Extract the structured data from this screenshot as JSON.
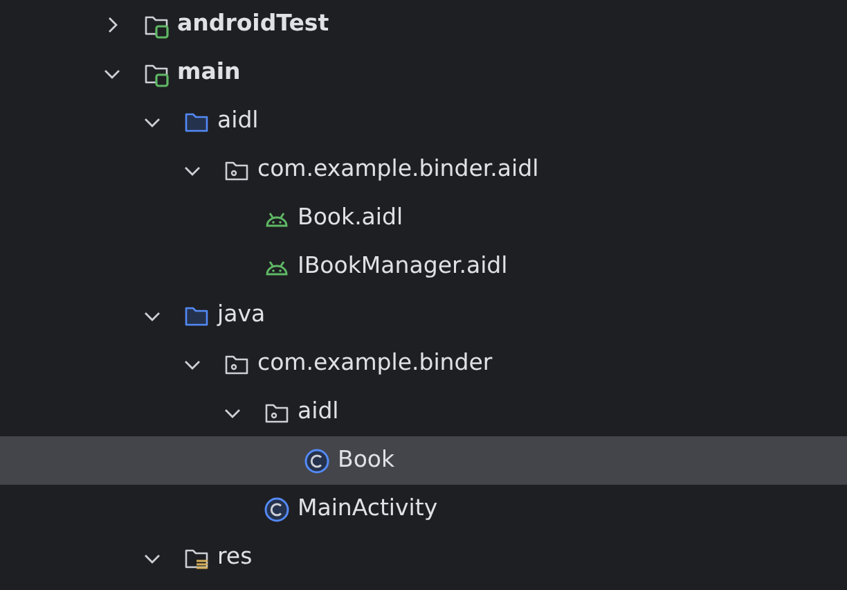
{
  "tree": [
    {
      "label": "androidTest",
      "kind": "module-folder",
      "expanded": false,
      "selected": false
    },
    {
      "label": "main",
      "kind": "module-folder",
      "expanded": true,
      "selected": false,
      "children": [
        {
          "label": "aidl",
          "kind": "source-folder",
          "expanded": true,
          "selected": false,
          "children": [
            {
              "label": "com.example.binder.aidl",
              "kind": "package",
              "expanded": true,
              "selected": false,
              "children": [
                {
                  "label": "Book.aidl",
                  "kind": "aidl-file",
                  "selected": false
                },
                {
                  "label": "IBookManager.aidl",
                  "kind": "aidl-file",
                  "selected": false
                }
              ]
            }
          ]
        },
        {
          "label": "java",
          "kind": "source-folder",
          "expanded": true,
          "selected": false,
          "children": [
            {
              "label": "com.example.binder",
              "kind": "package",
              "expanded": true,
              "selected": false,
              "children": [
                {
                  "label": "aidl",
                  "kind": "package",
                  "expanded": true,
                  "selected": false,
                  "children": [
                    {
                      "label": "Book",
                      "kind": "class",
                      "selected": true
                    }
                  ]
                },
                {
                  "label": "MainActivity",
                  "kind": "class",
                  "selected": false
                }
              ]
            }
          ]
        },
        {
          "label": "res",
          "kind": "resource-folder",
          "expanded": true,
          "selected": false
        }
      ]
    }
  ]
}
